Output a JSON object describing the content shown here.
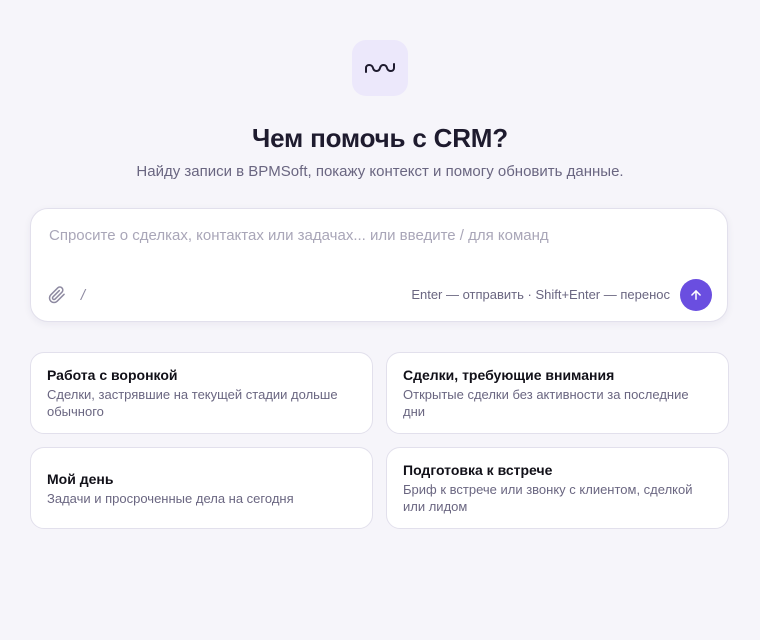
{
  "logo": {
    "icon": "wave-icon",
    "color": "#1e1b2e",
    "tile_color": "#ece8fb"
  },
  "header": {
    "title": "Чем помочь с CRM?",
    "subtitle": "Найду записи в BPMSoft, покажу контекст и помогу обновить данные."
  },
  "composer": {
    "placeholder": "Спросите о сделках, контактах или задачах... или введите / для команд",
    "value": "",
    "slash_label": "/",
    "hint": "Enter — отправить · Shift+Enter — перенос",
    "attach_icon": "paperclip-icon",
    "send_icon": "arrow-up-icon",
    "accent_color": "#6a4ee0"
  },
  "suggestions": [
    {
      "title": "Работа с воронкой",
      "description": "Сделки, застрявшие на текущей стадии дольше обычного"
    },
    {
      "title": "Сделки, требующие внимания",
      "description": "Открытые сделки без активности за последние дни"
    },
    {
      "title": "Мой день",
      "description": "Задачи и просроченные дела на сегодня"
    },
    {
      "title": "Подготовка к встрече",
      "description": "Бриф к встрече или звонку с клиентом, сделкой или лидом"
    }
  ]
}
